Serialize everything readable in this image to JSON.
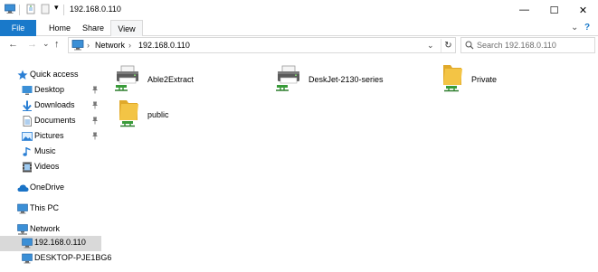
{
  "window": {
    "title": "192.168.0.110",
    "minimize_glyph": "—",
    "maximize_glyph": "☐",
    "close_glyph": "✕"
  },
  "ribbon": {
    "tabs": [
      {
        "label": "File"
      },
      {
        "label": "Home"
      },
      {
        "label": "Share"
      },
      {
        "label": "View"
      }
    ],
    "expand_glyph": "⌄",
    "help_glyph": "?"
  },
  "address": {
    "crumbs": [
      "Network",
      "192.168.0.110"
    ],
    "separator": "›",
    "refresh_glyph": "↻",
    "back_glyph": "←",
    "forward_glyph": "→",
    "history_glyph": "⌄",
    "up_glyph": "↑"
  },
  "search": {
    "placeholder": "Search 192.168.0.110"
  },
  "nav": {
    "quick_access": "Quick access",
    "desktop": "Desktop",
    "downloads": "Downloads",
    "documents": "Documents",
    "pictures": "Pictures",
    "music": "Music",
    "videos": "Videos",
    "onedrive": "OneDrive",
    "this_pc": "This PC",
    "network": "Network",
    "host1": "192.168.0.110",
    "host2": "DESKTOP-PJE1BG6"
  },
  "items": [
    {
      "label": "Able2Extract",
      "icon": "printer-icon"
    },
    {
      "label": "DeskJet-2130-series",
      "icon": "printer-icon"
    },
    {
      "label": "Private",
      "icon": "shared-folder-icon"
    },
    {
      "label": "public",
      "icon": "shared-folder-icon"
    }
  ],
  "colors": {
    "accent": "#1979ca",
    "selection": "#cce8ff",
    "selection_inactive": "#d9d9d9",
    "folder": "#f3c445",
    "network_green": "#3a9b3a"
  }
}
